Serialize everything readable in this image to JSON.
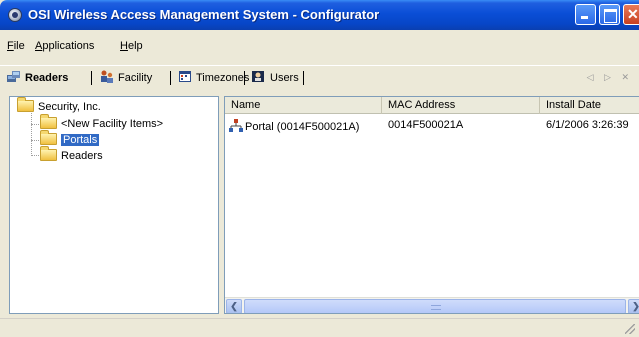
{
  "window": {
    "title": "OSI Wireless Access Management System - Configurator"
  },
  "menu": {
    "file": {
      "accel": "F",
      "rest": "ile"
    },
    "applications": {
      "accel": "A",
      "rest": "pplications"
    },
    "help": {
      "accel": "H",
      "rest": "elp"
    }
  },
  "toolbar": {
    "tabs": [
      {
        "label": "Readers",
        "icon": "readers-icon",
        "active": true
      },
      {
        "label": "Facility",
        "icon": "facility-icon"
      },
      {
        "label": "Timezones",
        "icon": "timezones-icon"
      },
      {
        "label": "Users",
        "icon": "users-icon"
      }
    ],
    "nav": "◁ ▷ ✕"
  },
  "tree": {
    "root": "Security, Inc.",
    "children": [
      "<New Facility Items>",
      "Portals",
      "Readers"
    ],
    "selected": "Portals"
  },
  "list": {
    "columns": [
      "Name",
      "MAC Address",
      "Install Date"
    ],
    "rows": [
      {
        "name": "Portal (0014F500021A)",
        "mac": "0014F500021A",
        "install_date": "6/1/2006 3:26:39"
      }
    ]
  },
  "colors": {
    "titlebar": "#0a4ed6",
    "selection": "#316ac5",
    "chrome": "#ece9d8"
  }
}
